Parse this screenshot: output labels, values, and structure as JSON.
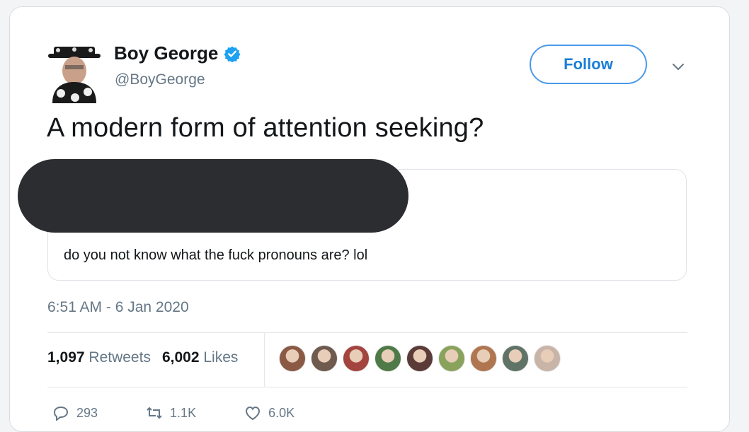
{
  "author": {
    "name": "Boy George",
    "handle": "@BoyGeorge",
    "verified": true
  },
  "header": {
    "follow_label": "Follow"
  },
  "tweet": {
    "text": "A modern form of attention seeking?",
    "timestamp": "6:51 AM - 6 Jan 2020"
  },
  "quoted_tweet": {
    "text": "do you not know what the fuck pronouns are? lol"
  },
  "stats": {
    "retweets_count": "1,097",
    "retweets_label": "Retweets",
    "likes_count": "6,002",
    "likes_label": "Likes"
  },
  "likers": [
    {
      "name": "liker-avatar-1",
      "color": "#8b5a45"
    },
    {
      "name": "liker-avatar-2",
      "color": "#6e5a4e"
    },
    {
      "name": "liker-avatar-3",
      "color": "#a3443f"
    },
    {
      "name": "liker-avatar-4",
      "color": "#4f7a47"
    },
    {
      "name": "liker-avatar-5",
      "color": "#5a3b37"
    },
    {
      "name": "liker-avatar-6",
      "color": "#8aa35c"
    },
    {
      "name": "liker-avatar-7",
      "color": "#b07650"
    },
    {
      "name": "liker-avatar-8",
      "color": "#5f7366"
    },
    {
      "name": "liker-avatar-9",
      "color": "#c9b4a8"
    }
  ],
  "actions": {
    "reply_count": "293",
    "retweet_count": "1.1K",
    "like_count": "6.0K"
  },
  "colors": {
    "accent": "#1da1f2",
    "follow_border": "#4a99e9",
    "secondary_text": "#657786",
    "redaction": "#2b2d30"
  }
}
